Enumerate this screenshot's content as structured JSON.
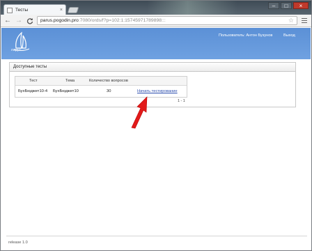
{
  "browser": {
    "tab_title": "Тесты",
    "tab_close": "×",
    "controls": {
      "minimize": "–",
      "maximize": "□",
      "close": "×"
    },
    "nav": {
      "back": "←",
      "forward": "→",
      "reload": "C"
    },
    "url_host": "parus.pogodin.pro",
    "url_path": ":7080/ords/f?p=102:1:15745971789898:::",
    "star": "☆"
  },
  "header": {
    "logo_text": "парус",
    "user_label": "Пользователь: Антон Бузунов",
    "logout_label": "Выход"
  },
  "panel": {
    "title": "Доступные тесты",
    "columns": [
      "Тест",
      "Тема",
      "Количество вопросов"
    ],
    "rows": [
      {
        "test": "БухБюджет10-4",
        "topic": "БухБюджет10",
        "questions": "30",
        "action": "Начать тестирование"
      }
    ],
    "pagination": "1 - 1"
  },
  "footer": {
    "release": "release 1.0"
  },
  "colors": {
    "header_blue": "#6a9ddf",
    "link": "#2a4cae",
    "arrow": "#e21b1b"
  }
}
